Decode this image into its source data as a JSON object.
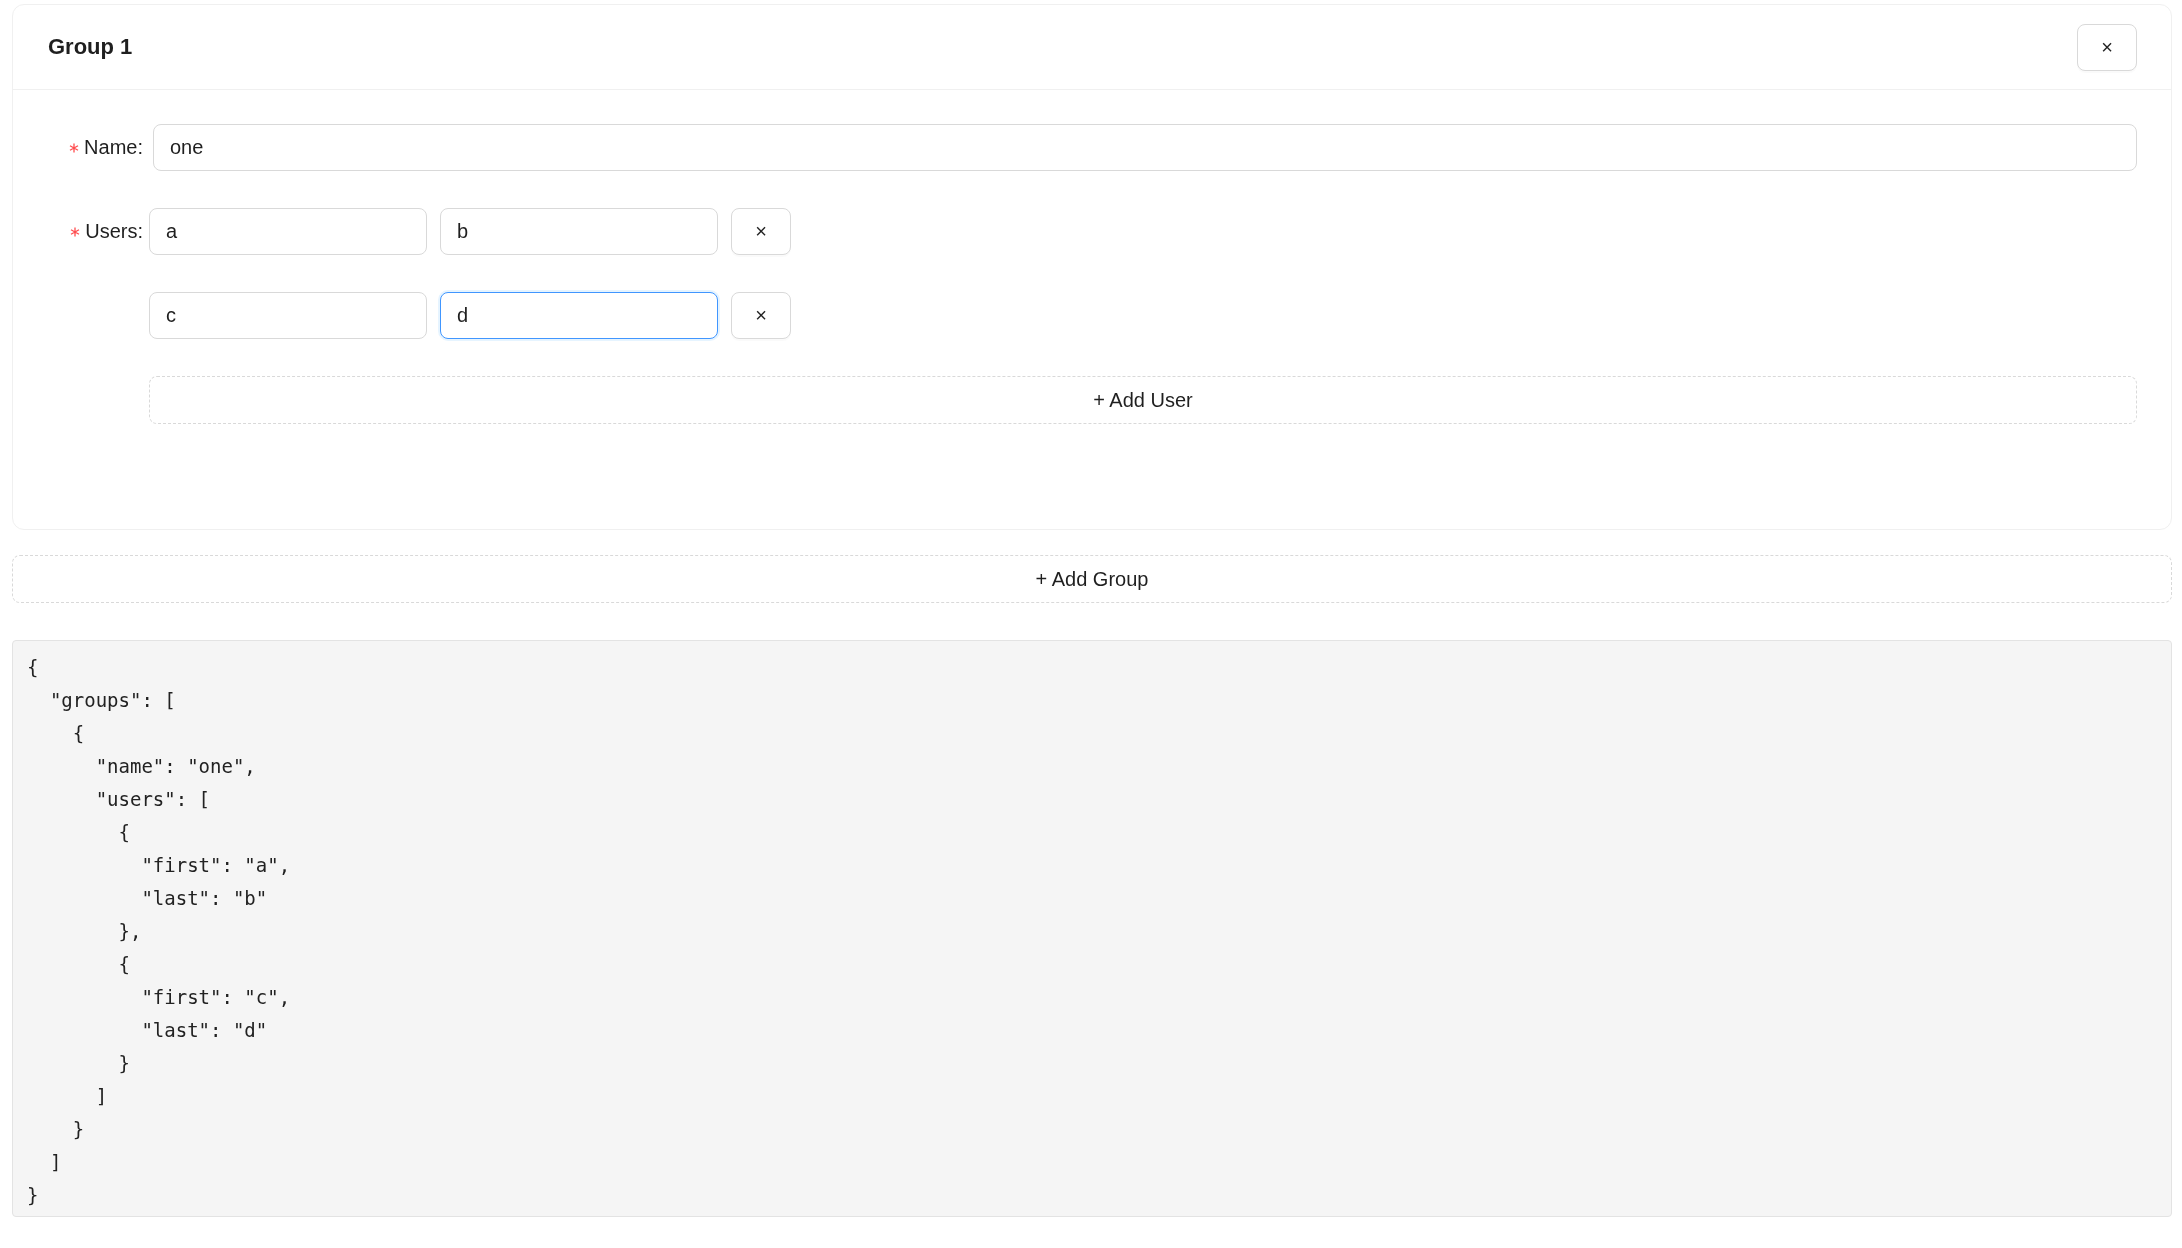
{
  "group": {
    "title": "Group 1",
    "close_label": "×",
    "name_field": {
      "label": "Name:",
      "required": true,
      "value": "one",
      "focused": false
    },
    "users_field": {
      "label": "Users:",
      "required": true,
      "rows": [
        {
          "first": {
            "value": "a",
            "focused": false
          },
          "last": {
            "value": "b",
            "focused": false
          },
          "remove_label": "×"
        },
        {
          "first": {
            "value": "c",
            "focused": false
          },
          "last": {
            "value": "d",
            "focused": true
          },
          "remove_label": "×"
        }
      ]
    },
    "add_user_label": "+ Add User"
  },
  "add_group_label": "+ Add Group",
  "output": "{\n  \"groups\": [\n    {\n      \"name\": \"one\",\n      \"users\": [\n        {\n          \"first\": \"a\",\n          \"last\": \"b\"\n        },\n        {\n          \"first\": \"c\",\n          \"last\": \"d\"\n        }\n      ]\n    }\n  ]\n}"
}
